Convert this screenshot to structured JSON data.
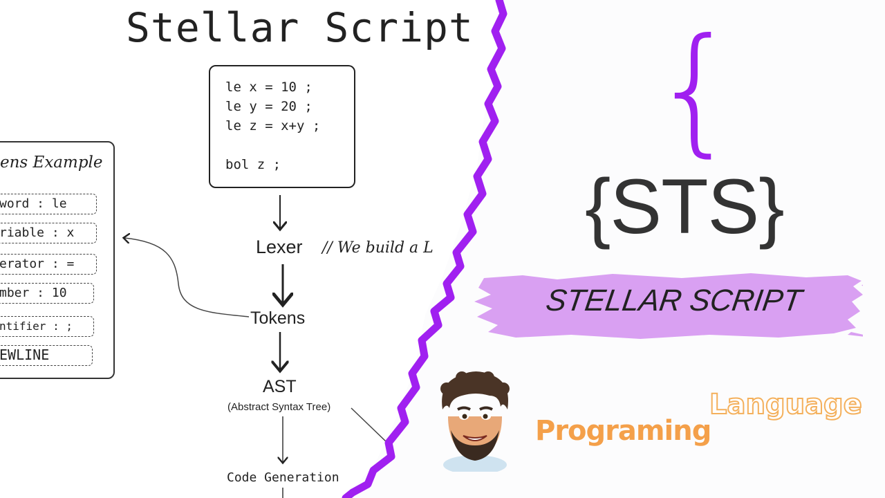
{
  "title": "Stellar Script",
  "code": {
    "lines": [
      "le x = 10 ;",
      "le y = 20 ;",
      "le z = x+y ;",
      "",
      "bol z ;"
    ]
  },
  "tokens_card": {
    "title": "ens Example",
    "items": [
      "word : le",
      "riable : x",
      "erator : =",
      "mber : 10",
      "ntifier : ;",
      "EWLINE"
    ]
  },
  "flow": {
    "lexer": "Lexer",
    "lexer_comment": "// We build a L",
    "tokens": "Tokens",
    "ast": "AST",
    "ast_sub": "(Abstract Syntax Tree)",
    "codegen": "Code Generation"
  },
  "logo": {
    "brace": "{",
    "text": "{STS}"
  },
  "banner": {
    "text": "STELLAR SCRIPT",
    "color": "#d9a0f2"
  },
  "tagline": {
    "word1": "Programing",
    "word2": "Language",
    "color": "#f4a04a"
  },
  "colors": {
    "divider": "#a020f0",
    "ink": "#222222"
  },
  "icons": {
    "avatar": "cartoon-avatar-icon"
  }
}
